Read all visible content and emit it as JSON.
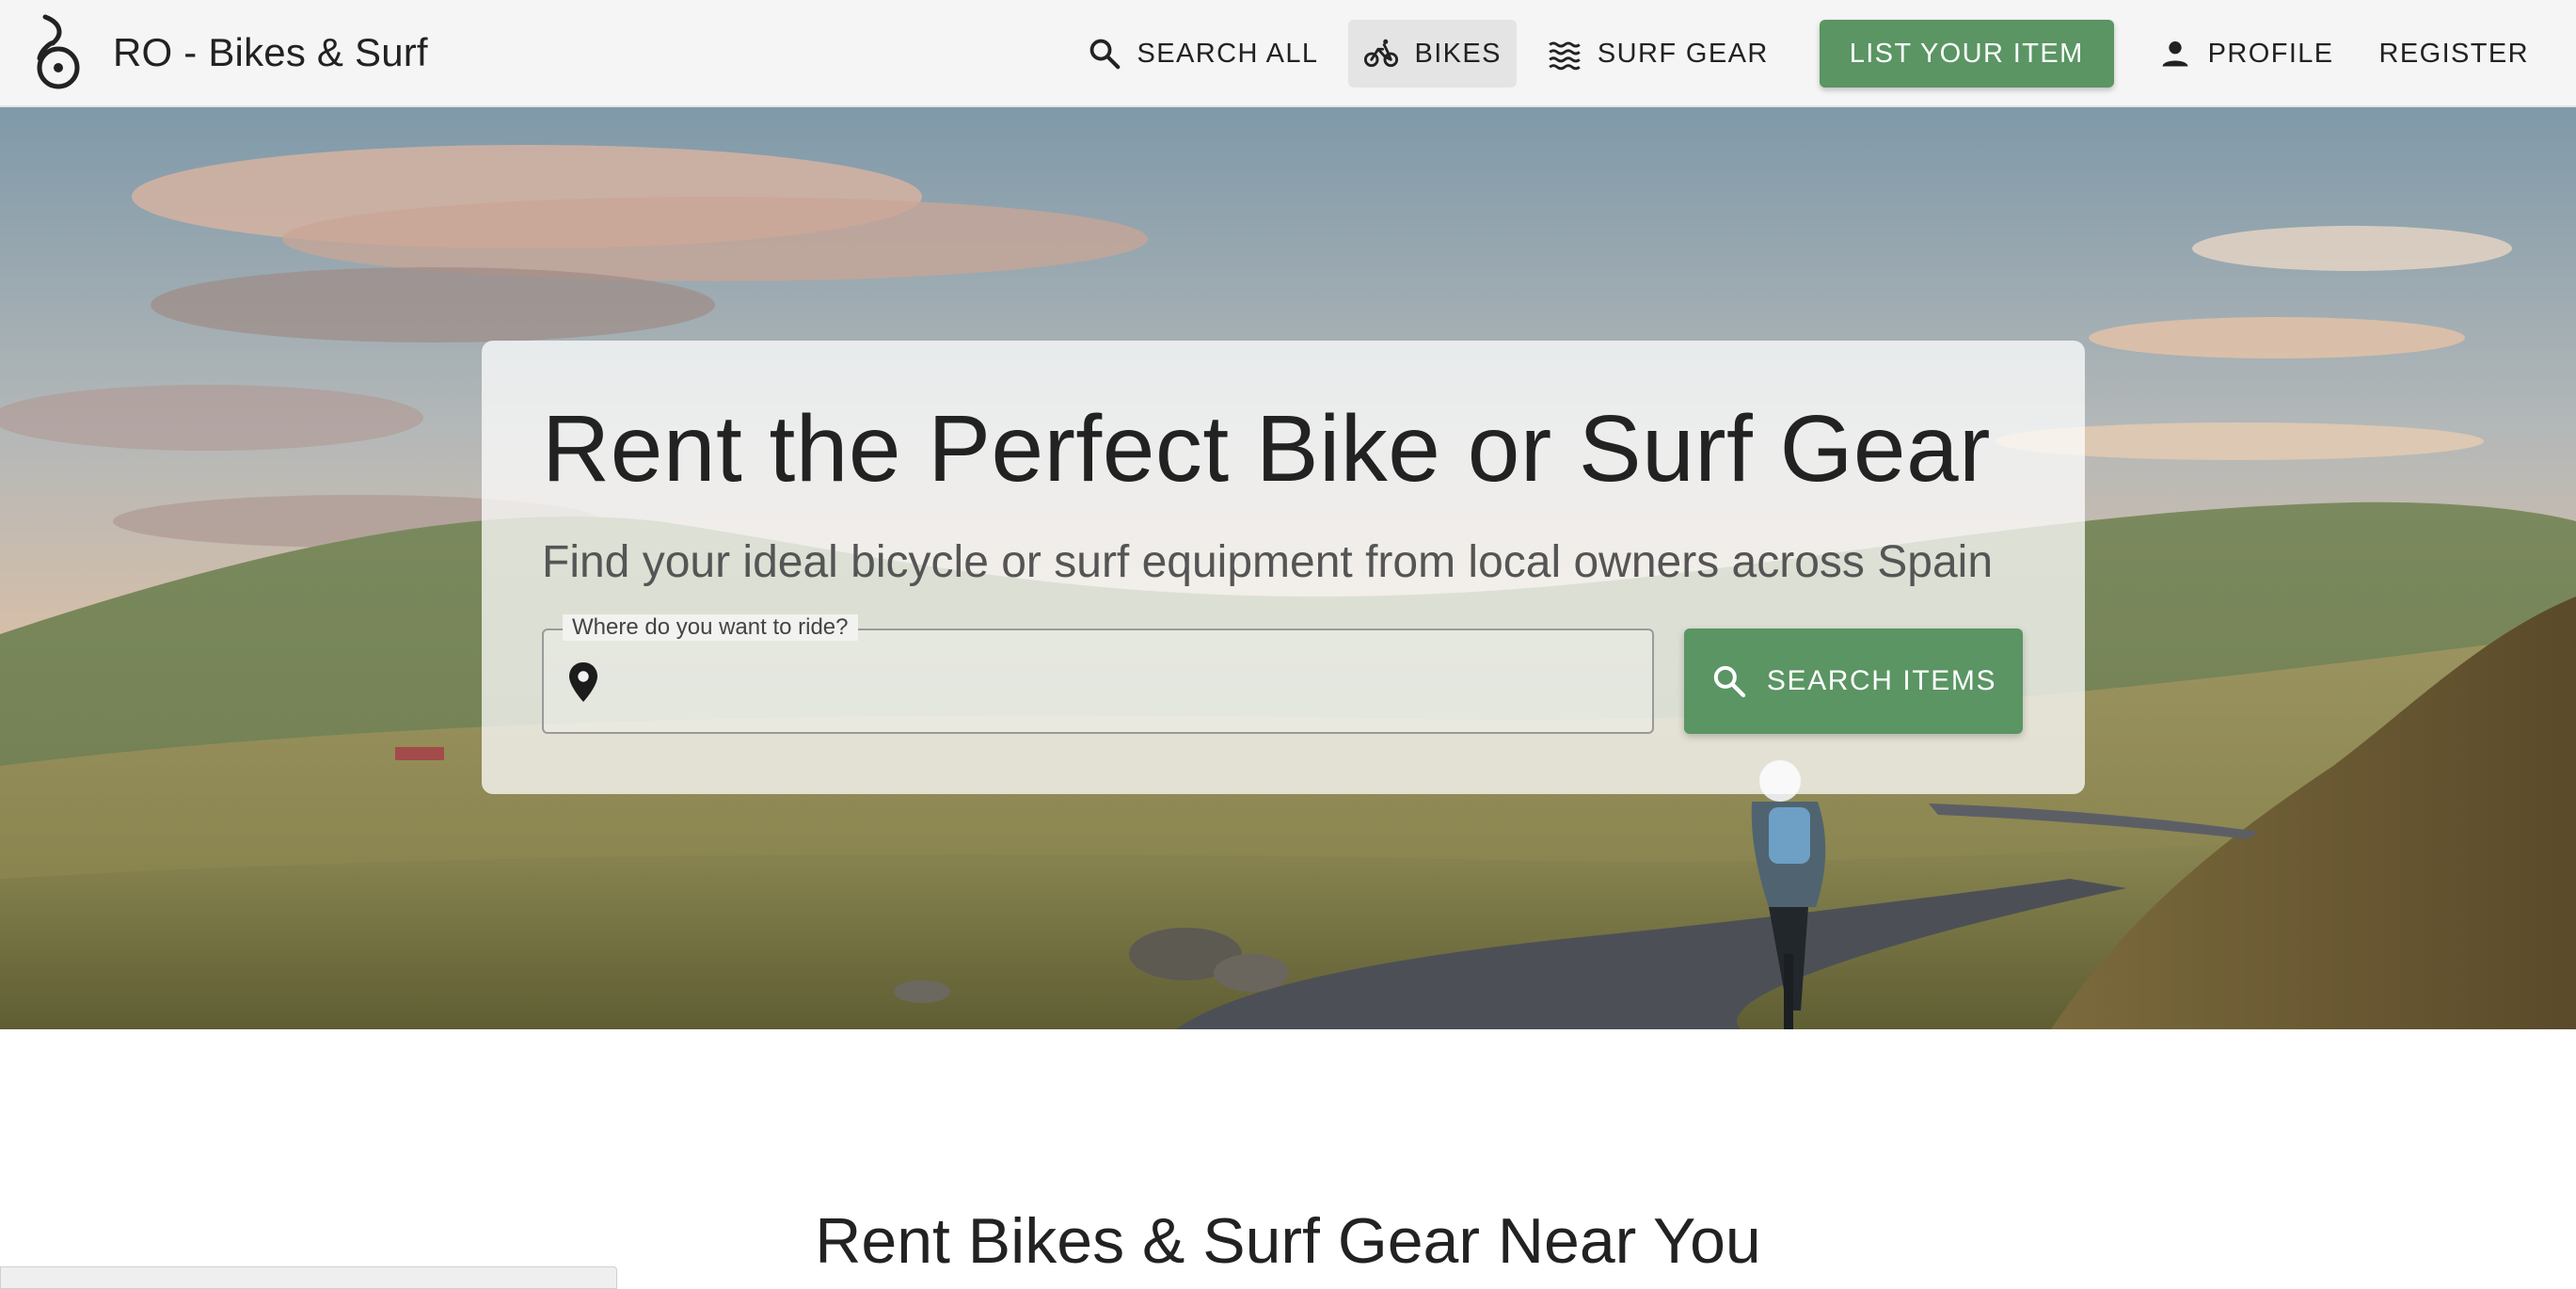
{
  "app": {
    "title": "RO - Bikes & Surf",
    "logo_icon": "bike-hook-logo-icon"
  },
  "nav": {
    "items": [
      {
        "label": "Search All",
        "icon": "search-icon",
        "active": false
      },
      {
        "label": "Bikes",
        "icon": "bicycle-icon",
        "active": true
      },
      {
        "label": "Surf Gear",
        "icon": "waves-icon",
        "active": false
      },
      {
        "label": "List Your Item",
        "primary": true
      },
      {
        "label": "Profile",
        "icon": "person-icon",
        "active": false
      },
      {
        "label": "Register",
        "active": false
      }
    ]
  },
  "hero": {
    "title": "Rent the Perfect Bike or Surf Gear",
    "subtitle": "Find your ideal bicycle or surf equipment from local owners across Spain",
    "location_field": {
      "label": "Where do you want to ride?",
      "value": "",
      "icon": "location-pin-icon"
    },
    "search_button": {
      "label": "Search Items",
      "icon": "search-icon"
    },
    "background": "cyclist-on-hillside-road-photo"
  },
  "section": {
    "title": "Rent Bikes & Surf Gear Near You"
  },
  "colors": {
    "primary": "#5a9563",
    "appbar_bg": "#f5f5f5",
    "text": "#222222"
  }
}
